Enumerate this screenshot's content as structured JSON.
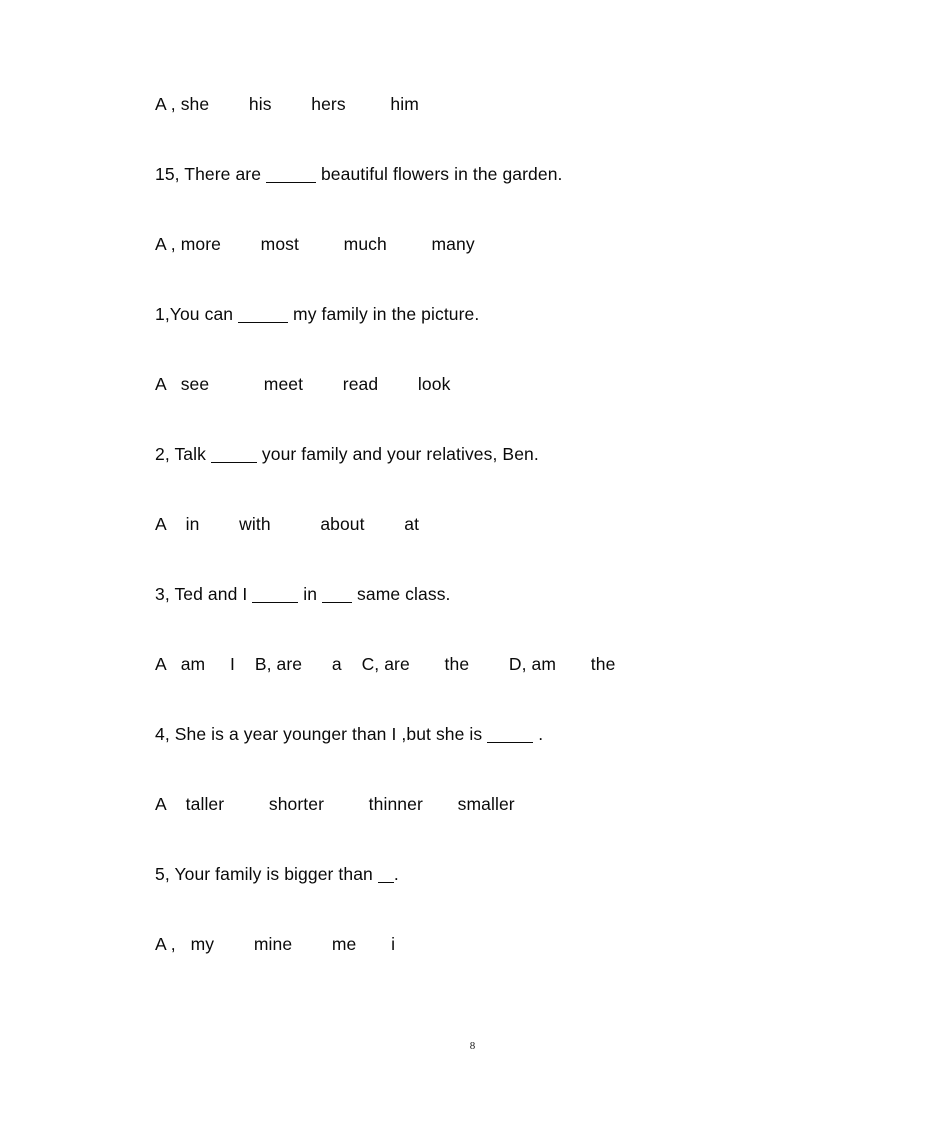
{
  "document": {
    "page_number": "8",
    "background_color": "#ffffff",
    "text_color": "#0a0a0a",
    "lines": [
      {
        "id": "options-14",
        "type": "options",
        "text": "A , she        his        hers         him"
      },
      {
        "id": "question-15",
        "type": "question",
        "prefix": "15, There are ",
        "blank": "lg",
        "suffix": " beautiful flowers in the garden."
      },
      {
        "id": "options-15",
        "type": "options",
        "text": "A , more        most         much         many"
      },
      {
        "id": "question-1",
        "type": "question",
        "prefix": "1,You can ",
        "blank": "lg",
        "suffix": " my family in the picture."
      },
      {
        "id": "options-1",
        "type": "options",
        "text": "A   see           meet        read        look"
      },
      {
        "id": "question-2",
        "type": "question",
        "prefix": "2, Talk ",
        "blank": "md",
        "suffix": " your family and your relatives, Ben."
      },
      {
        "id": "options-2",
        "type": "options",
        "text": "A    in        with          about        at"
      },
      {
        "id": "question-3",
        "type": "question",
        "prefix": "3, Ted and I ",
        "blank": "md",
        "middle": " in ",
        "blank2": "sm",
        "suffix": " same class."
      },
      {
        "id": "options-3",
        "type": "options",
        "text": "A   am     I    B, are      a    C, are       the        D, am       the"
      },
      {
        "id": "question-4",
        "type": "question",
        "prefix": "4, She is a year younger than I ,but she is ",
        "blank": "md",
        "suffix": " ."
      },
      {
        "id": "options-4",
        "type": "options",
        "text": "A    taller         shorter         thinner       smaller"
      },
      {
        "id": "question-5",
        "type": "question",
        "prefix": "5, Your family is bigger than ",
        "blank": "xs",
        "suffix": "."
      },
      {
        "id": "options-5",
        "type": "options",
        "text": "A ,   my        mine        me       i"
      }
    ]
  }
}
